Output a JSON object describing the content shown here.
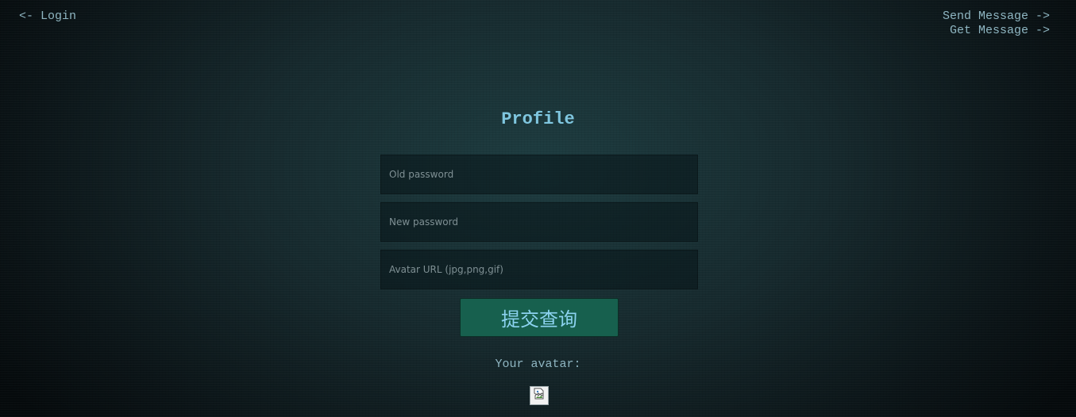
{
  "nav": {
    "login_label": "<- Login",
    "send_message_label": "Send Message ->",
    "get_message_label": "Get Message ->"
  },
  "page": {
    "title": "Profile"
  },
  "form": {
    "old_password": {
      "placeholder": "Old password",
      "value": ""
    },
    "new_password": {
      "placeholder": "New password",
      "value": ""
    },
    "avatar_url": {
      "placeholder": "Avatar URL (jpg,png,gif)",
      "value": ""
    },
    "submit_label": "提交查询"
  },
  "avatar": {
    "label": "Your avatar:",
    "icon": "broken-image-icon"
  },
  "colors": {
    "background": "#16292d",
    "link_text": "#8fb6c2",
    "title_text": "#7fc6df",
    "button_bg": "#17604e",
    "button_text": "#8cd3f0"
  }
}
